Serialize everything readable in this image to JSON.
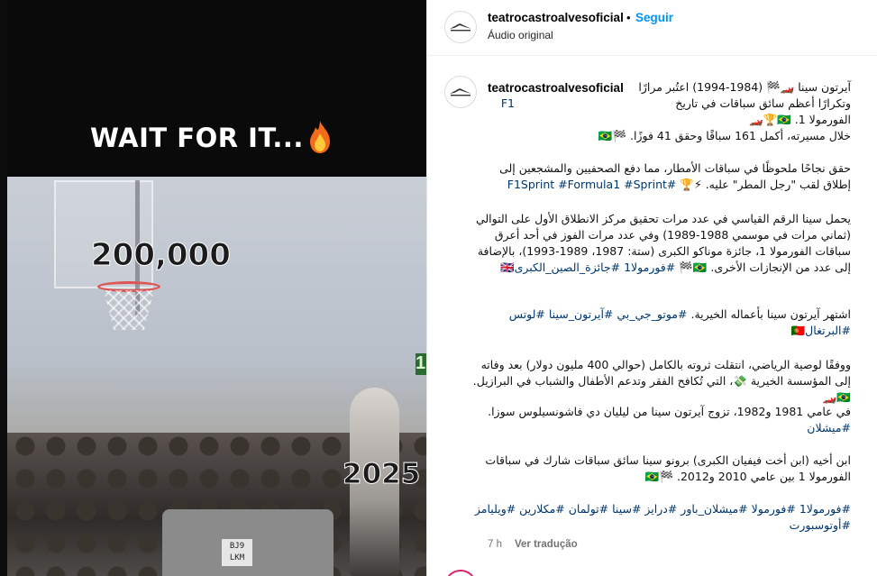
{
  "media": {
    "overlay_text": "WAIT FOR IT...",
    "overlay_emoji": "🔥",
    "counter_top": "200,000",
    "counter_bottom": "2025",
    "plate_text": "BJ9\nLKM",
    "edge_text": "1"
  },
  "header": {
    "username": "teatrocastroalvesoficial",
    "separator": "•",
    "follow_label": "Seguir",
    "audio_label": "Áudio original"
  },
  "caption": {
    "username": "teatrocastroalvesoficial",
    "p1": "آيرتون سينا 🏎️🏁 (1984-1994) اعتُبر مرارًا وتكرارًا أعظم سائق سباقات في تاريخ الفورمولا 1. 🇧🇷🏆🏎️",
    "p1_tag": "F1",
    "p2": "خلال مسيرته، أكمل 161 سباقًا وحقق 41 فوزًا. 🏁🇧🇷",
    "p3": "حقق نجاحًا ملحوظًا في سباقات الأمطار، مما دفع الصحفيين والمشجعين إلى إطلاق لقب \"رجل المطر\" عليه. ⚡🏆",
    "p3_tags": "#F1Sprint #Formula1 #Sprint",
    "p4": "يحمل سينا الرقم القياسي في عدد مرات تحقيق مركز الانطلاق الأول على التوالي (ثماني مرات في موسمي 1988-1989) وفي عدد مرات الفوز في أحد أعرق سباقات الفورمولا 1، جائزة موناكو الكبرى (ستة: 1987، 1989-1993)، بالإضافة إلى عدد من الإنجازات الأخرى. 🇧🇷🏁",
    "p4_tags": "#فورمولا1 #جائزة_الصين_الكبرى🇬🇧",
    "p5": "اشتهر آيرتون سينا بأعماله الخيرية.",
    "p5_tags": "#موتو_جي_بي #آيرتون_سينا #لوتس #البرتغال🇵🇹",
    "p6": "ووفقًا لوصية الرياضي، انتقلت ثروته بالكامل (حوالي 400 مليون دولار) بعد وفاته إلى المؤسسة الخيرية 💸، التي تُكافح الفقر وتدعم الأطفال والشباب في البرازيل. 🇧🇷🏎️",
    "p7": "في عامي 1981 و1982، تزوج آيرتون سينا من ليليان دي فاشونسيلوس سوزا.",
    "p7_tags": "#ميشلان",
    "p8": "ابن أخيه (ابن أخت فيفيان الكبرى) برونو سينا سائق سباقات شارك في سباقات الفورمولا 1 بين عامي 2010 و2012. 🏁🇧🇷",
    "p9_tags": "#فورمولا1 #فورمولا #ميشلان_باور #درايز #سينا #تولمان #مكلارين #ويليامز #أوتوسبورت",
    "time": "7 h",
    "translate_label": "Ver tradução"
  },
  "colors": {
    "accent": "#0095f6",
    "hashtag": "#00376b",
    "muted": "#737373"
  }
}
